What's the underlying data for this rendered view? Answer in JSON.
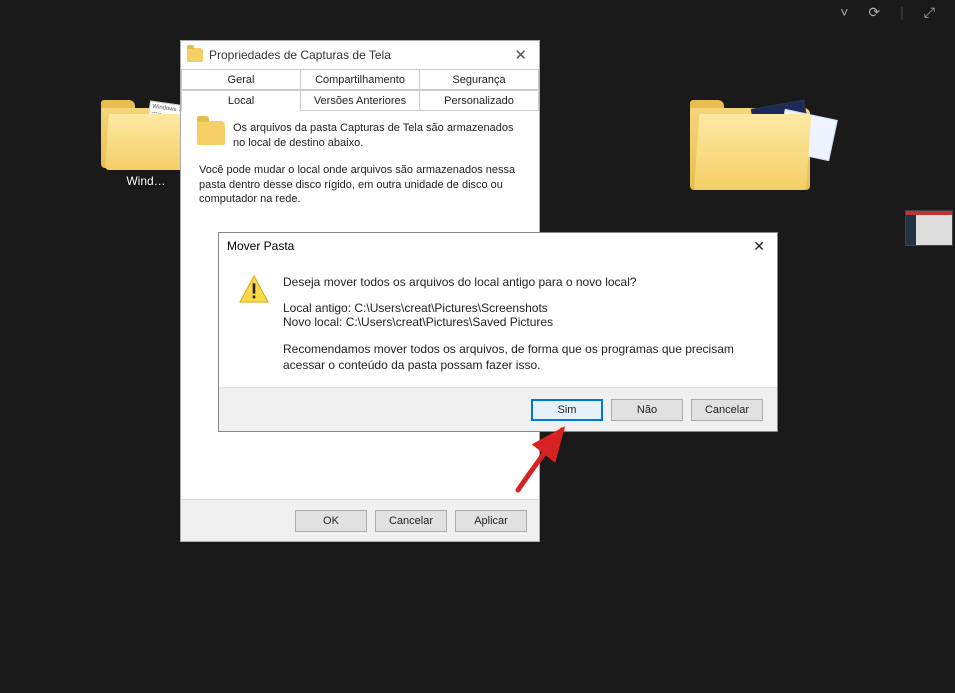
{
  "topbar": {
    "chevron": "˅",
    "refresh": "⟳",
    "search": "⤢"
  },
  "desktop": {
    "left": {
      "label": "Wind…"
    },
    "right": {
      "label": ""
    }
  },
  "properties": {
    "title": "Propriedades de Capturas de Tela",
    "tabs_row1": [
      "Geral",
      "Compartilhamento",
      "Segurança"
    ],
    "tabs_row2": [
      "Local",
      "Versões Anteriores",
      "Personalizado"
    ],
    "active_tab": "Local",
    "summary": "Os arquivos da pasta Capturas de Tela são armazenados no local de destino abaixo.",
    "explain": "Você pode mudar o local onde arquivos são armazenados nessa pasta dentro desse disco rígido, em outra unidade de disco ou computador na rede.",
    "footer": {
      "ok": "OK",
      "cancel": "Cancelar",
      "apply": "Aplicar"
    }
  },
  "confirm": {
    "title": "Mover Pasta",
    "question": "Deseja mover todos os arquivos do local antigo para o novo local?",
    "old_label": "Local antigo: C:\\Users\\creat\\Pictures\\Screenshots",
    "new_label": "Novo local: C:\\Users\\creat\\Pictures\\Saved Pictures",
    "recommend": "Recomendamos mover todos os arquivos, de forma que os programas que precisam acessar o conteúdo da pasta possam fazer isso.",
    "yes": "Sim",
    "no": "Não",
    "cancel": "Cancelar"
  }
}
